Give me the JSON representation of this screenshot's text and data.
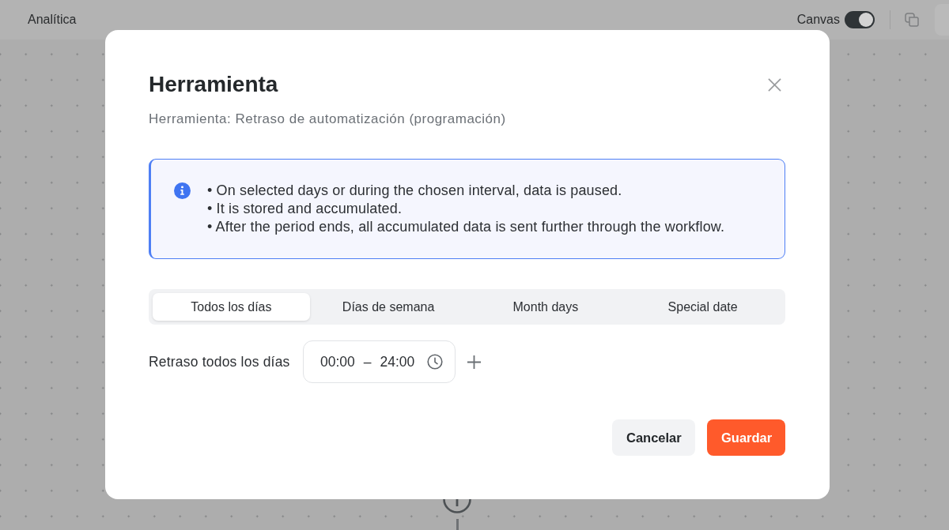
{
  "top_bar": {
    "title": "Analítica",
    "canvas_toggle": {
      "label": "Canvas",
      "on": true
    }
  },
  "dialog": {
    "title": "Herramienta",
    "subtitle": "Herramienta: Retraso de automatización (programación)",
    "info": {
      "bullets": [
        "• On selected days or during the chosen interval, data is paused.",
        "• It is stored and accumulated.",
        "• After the period ends, all accumulated data is sent further through the workflow."
      ]
    },
    "tabs": [
      {
        "label": "Todos los días",
        "selected": true
      },
      {
        "label": "Días de semana",
        "selected": false
      },
      {
        "label": "Month days",
        "selected": false
      },
      {
        "label": "Special date",
        "selected": false
      }
    ],
    "delay_row": {
      "label": "Retraso todos los días",
      "start": "00:00",
      "separator": "–",
      "end": "24:00"
    },
    "buttons": [
      {
        "label": "Cancelar",
        "kind": "secondary"
      },
      {
        "label": "Guardar",
        "kind": "primary"
      }
    ]
  }
}
